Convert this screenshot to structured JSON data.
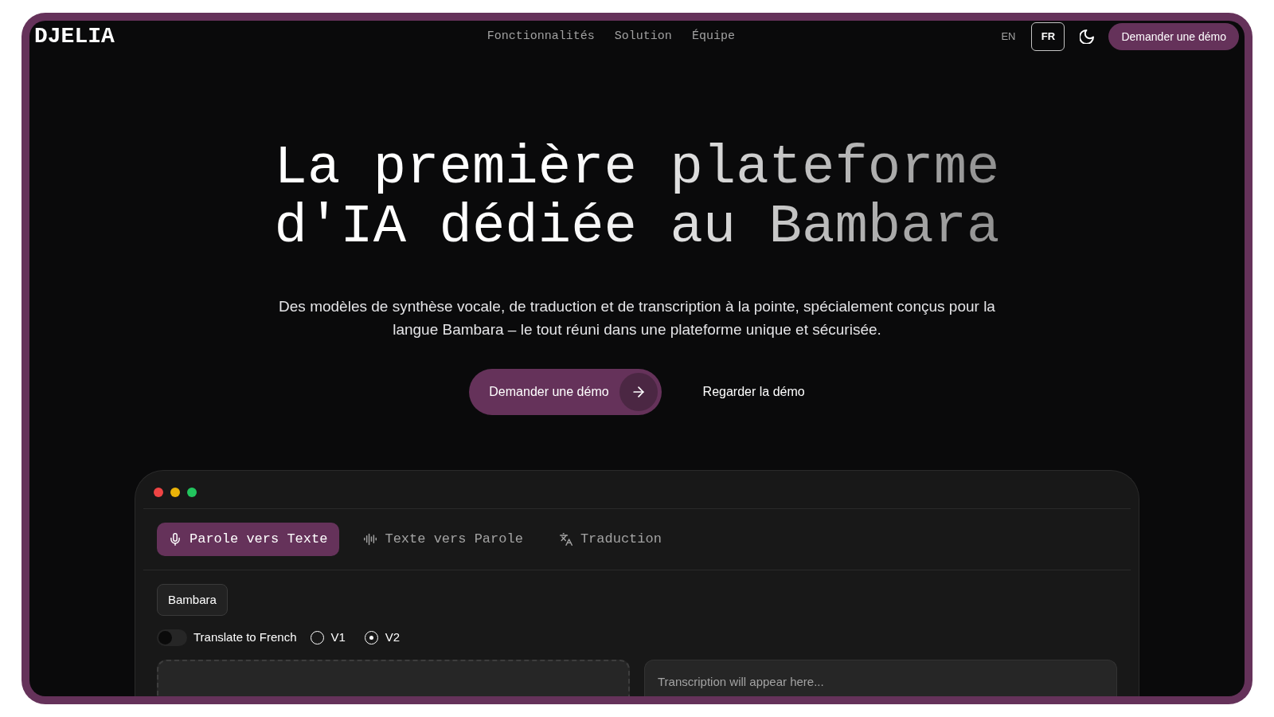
{
  "header": {
    "logo": "DJELIA",
    "nav": [
      "Fonctionnalités",
      "Solution",
      "Équipe"
    ],
    "languages": [
      {
        "label": "EN",
        "selected": false
      },
      {
        "label": "FR",
        "selected": true
      }
    ],
    "demo_button": "Demander une démo"
  },
  "hero": {
    "title": "La première plateforme d'IA dédiée au Bambara",
    "subtitle": "Des modèles de synthèse vocale, de traduction et de transcription à la pointe, spécialement conçus pour la langue Bambara – le tout réuni dans une plateforme unique et sécurisée.",
    "primary_button": "Demander une démo",
    "secondary_link": "Regarder la démo"
  },
  "demo_window": {
    "tabs": [
      {
        "label": "Parole vers Texte",
        "selected": true
      },
      {
        "label": "Texte vers Parole",
        "selected": false
      },
      {
        "label": "Traduction",
        "selected": false
      }
    ],
    "language_button": "Bambara",
    "translate_toggle": {
      "label": "Translate to French",
      "on": false
    },
    "versions": [
      {
        "label": "V1",
        "selected": false
      },
      {
        "label": "V2",
        "selected": true
      }
    ],
    "output": {
      "placeholder": "Transcription will appear here..."
    }
  }
}
